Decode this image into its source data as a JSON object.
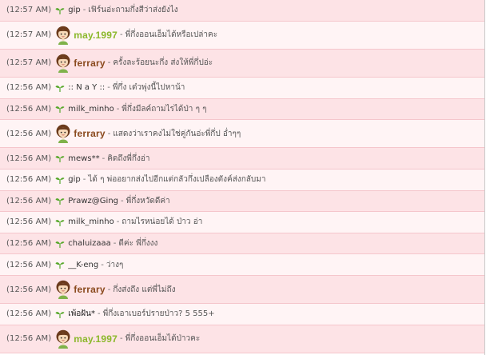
{
  "colors": {
    "row_odd": "#fde3e6",
    "row_even": "#fff4f5",
    "row_border": "#f5c6cc",
    "sprout_green": "#56a82a",
    "styled_green": "#8bb82b",
    "styled_brown": "#8a4a1e"
  },
  "icons": {
    "sprout": "sprout-icon",
    "avatar": "cartoon-girl-avatar-icon"
  },
  "separator": " - ",
  "messages": [
    {
      "time": "(12:57 AM)",
      "icon": "sprout",
      "user": "gip",
      "text": "เฟิร์นอ่ะถามกึ่งสีว่าส่งยังไง",
      "style": "plain",
      "tall": false
    },
    {
      "time": "(12:57 AM)",
      "icon": "avatar",
      "user": "may.1997",
      "text": "พี่กึ่งออนเอ็มได้หรือเปล่าคะ",
      "style": "green",
      "tall": true
    },
    {
      "time": "(12:57 AM)",
      "icon": "avatar",
      "user": "ferrary",
      "text": "ครั้งละร้อยนะกึ่ง ส่งให้พี่กึ่ปอ่ะ",
      "style": "brown",
      "tall": true
    },
    {
      "time": "(12:56 AM)",
      "icon": "sprout",
      "user": ":: N a Y ::",
      "text": "พี่กึ่ง เด๋วพุ่งนี้ไปหาน้า",
      "style": "plain",
      "tall": false
    },
    {
      "time": "(12:56 AM)",
      "icon": "sprout",
      "user": "milk_minho",
      "text": "พี่กึ่งมีลค์ถามไรได้ป่า ๆ ๆ",
      "style": "plain",
      "tall": false
    },
    {
      "time": "(12:56 AM)",
      "icon": "avatar",
      "user": "ferrary",
      "text": "แสดงว่าเราคงไม่ใช่คู่กันอ่ะพี่กึ่ป อ่ำๆๆ",
      "style": "brown",
      "tall": true
    },
    {
      "time": "(12:56 AM)",
      "icon": "sprout",
      "user": "mews**",
      "text": "คิดถึงพี่กึ่งอ่า",
      "style": "plain",
      "tall": false
    },
    {
      "time": "(12:56 AM)",
      "icon": "sprout",
      "user": "gip",
      "text": "ได้ ๆ พ่ออยากส่งไปอีกแต่กลัวกึ่งเปลืองตังค์ส่งกลับมา",
      "style": "plain",
      "tall": false
    },
    {
      "time": "(12:56 AM)",
      "icon": "sprout",
      "user": "Prawz@Ging",
      "text": "พี่กึ่งหวัดดีค่า",
      "style": "plain",
      "tall": false
    },
    {
      "time": "(12:56 AM)",
      "icon": "sprout",
      "user": "milk_minho",
      "text": "ถามไรหน่อยได้ ป่าว อ่า",
      "style": "plain",
      "tall": false
    },
    {
      "time": "(12:56 AM)",
      "icon": "sprout",
      "user": "chaluizaaa",
      "text": "ดีค่ะ พี่กึ่งงง",
      "style": "plain",
      "tall": false
    },
    {
      "time": "(12:56 AM)",
      "icon": "sprout",
      "user": "__K-eng",
      "text": "ว่างๆ",
      "style": "plain",
      "tall": false
    },
    {
      "time": "(12:56 AM)",
      "icon": "avatar",
      "user": "ferrary",
      "text": "กึ่งส่งถึง แต่พี่ไม่ถึง",
      "style": "brown",
      "tall": true
    },
    {
      "time": "(12:56 AM)",
      "icon": "sprout",
      "user": "เพ้อฝัน*",
      "text": "พี่กึ่งเอาเบอร์ปรายป่าว? 5 555+",
      "style": "dark",
      "tall": false
    },
    {
      "time": "(12:56 AM)",
      "icon": "avatar",
      "user": "may.1997",
      "text": "พี่กึ่งออนเอ็มได้ป่าวคะ",
      "style": "green",
      "tall": true
    }
  ]
}
